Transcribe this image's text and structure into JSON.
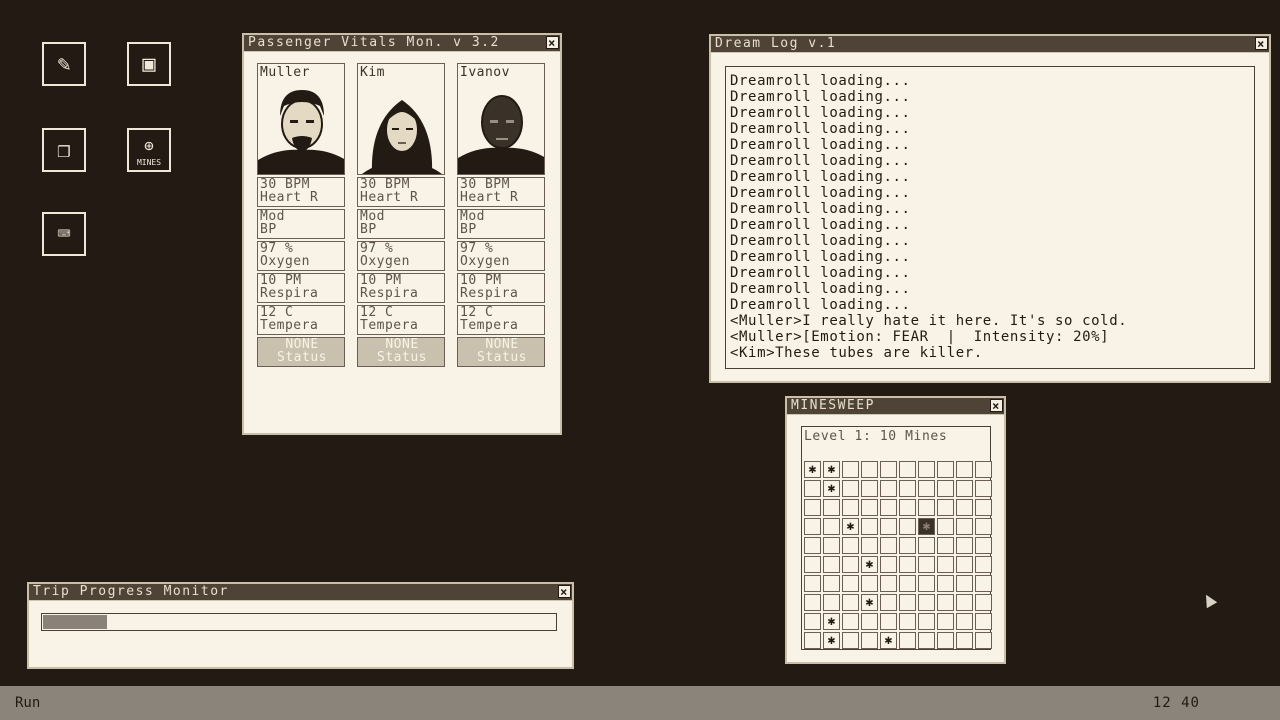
{
  "desktop": {
    "icons": [
      {
        "name": "diagnostics-icon"
      },
      {
        "name": "files-icon"
      },
      {
        "name": "chat-icon"
      },
      {
        "name": "mines-icon",
        "label": "MINES"
      },
      {
        "name": "terminal-icon"
      }
    ]
  },
  "vitals": {
    "title": "Passenger Vitals Mon. v 3.2",
    "passengers": [
      {
        "name": "Muller",
        "heart_val": "30 BPM",
        "heart_lbl": "Heart R",
        "bp_val": "Mod",
        "bp_lbl": "BP",
        "oxy_val": "97 %",
        "oxy_lbl": "Oxygen",
        "resp_val": "10 PM",
        "resp_lbl": "Respira",
        "temp_val": "12 C",
        "temp_lbl": "Tempera",
        "status_val": "NONE",
        "status_lbl": "Status"
      },
      {
        "name": "Kim",
        "heart_val": "30 BPM",
        "heart_lbl": "Heart R",
        "bp_val": "Mod",
        "bp_lbl": "BP",
        "oxy_val": "97 %",
        "oxy_lbl": "Oxygen",
        "resp_val": "10 PM",
        "resp_lbl": "Respira",
        "temp_val": "12 C",
        "temp_lbl": "Tempera",
        "status_val": "NONE",
        "status_lbl": "Status"
      },
      {
        "name": "Ivanov",
        "heart_val": "30 BPM",
        "heart_lbl": "Heart R",
        "bp_val": "Mod",
        "bp_lbl": "BP",
        "oxy_val": "97 %",
        "oxy_lbl": "Oxygen",
        "resp_val": "10 PM",
        "resp_lbl": "Respira",
        "temp_val": "12 C",
        "temp_lbl": "Tempera",
        "status_val": "NONE",
        "status_lbl": "Status"
      }
    ]
  },
  "dreamlog": {
    "title": "Dream Log v.1",
    "lines": [
      "Dreamroll loading...",
      "Dreamroll loading...",
      "Dreamroll loading...",
      "Dreamroll loading...",
      "Dreamroll loading...",
      "Dreamroll loading...",
      "Dreamroll loading...",
      "Dreamroll loading...",
      "Dreamroll loading...",
      "Dreamroll loading...",
      "Dreamroll loading...",
      "Dreamroll loading...",
      "Dreamroll loading...",
      "Dreamroll loading...",
      "Dreamroll loading...",
      "<Muller>I really hate it here. It's so cold.",
      "<Muller>[Emotion: FEAR  |  Intensity: 20%]",
      "<Kim>These tubes are killer."
    ]
  },
  "minesweep": {
    "title": "MINESWEEP",
    "level": "Level 1: 10 Mines",
    "mine_glyph": "✱",
    "rows": [
      "MM........",
      ".M........",
      "..........",
      "..M...X...",
      "..........",
      "...M......",
      "..........",
      "...M......",
      ".M........",
      ".M..M....."
    ]
  },
  "trip": {
    "title": "Trip Progress Monitor",
    "progress": 0.125
  },
  "taskbar": {
    "run_label": "Run",
    "clock": "12 40"
  }
}
